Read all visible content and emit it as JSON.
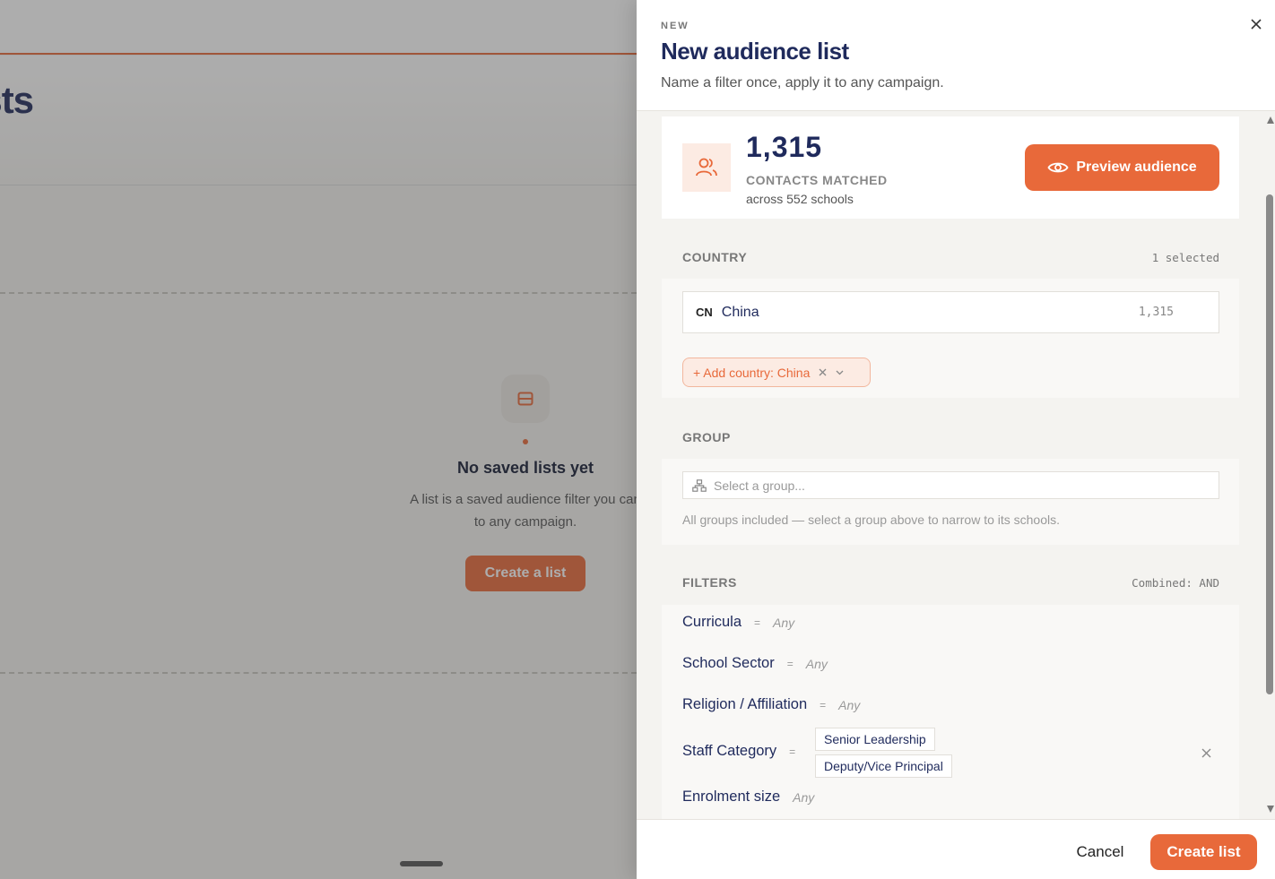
{
  "background": {
    "page_title": "lists",
    "empty_state": {
      "title": "No saved lists yet",
      "description_line1": "A list is a saved audience filter you can",
      "description_line2": "to any campaign.",
      "button_label": "Create a list"
    }
  },
  "drawer": {
    "eyebrow": "NEW",
    "title": "New audience list",
    "subtitle": "Name a filter once, apply it to any campaign.",
    "summary": {
      "count": "1,315",
      "count_label": "CONTACTS MATCHED",
      "sub": "across 552 schools",
      "preview_label": "Preview audience"
    },
    "country": {
      "label": "COUNTRY",
      "meta": "1 selected",
      "selected": [
        {
          "code": "CN",
          "name": "China",
          "count": "1,315"
        }
      ],
      "add_chip_label": "+ Add country: China"
    },
    "group": {
      "label": "GROUP",
      "placeholder": "Select a group...",
      "hint": "All groups included — select a group above to narrow to its schools."
    },
    "filters": {
      "label": "FILTERS",
      "meta": "Combined: AND",
      "eq": "=",
      "any": "Any",
      "rows": [
        {
          "name": "Curricula"
        },
        {
          "name": "School Sector"
        },
        {
          "name": "Religion / Affiliation"
        },
        {
          "name": "Staff Category",
          "tags": [
            "Senior Leadership",
            "Deputy/Vice Principal"
          ]
        },
        {
          "name": "Enrolment size"
        }
      ]
    },
    "footer": {
      "cancel_label": "Cancel",
      "create_label": "Create list"
    }
  },
  "colors": {
    "accent": "#e8693a",
    "navy": "#1f2a5c"
  }
}
